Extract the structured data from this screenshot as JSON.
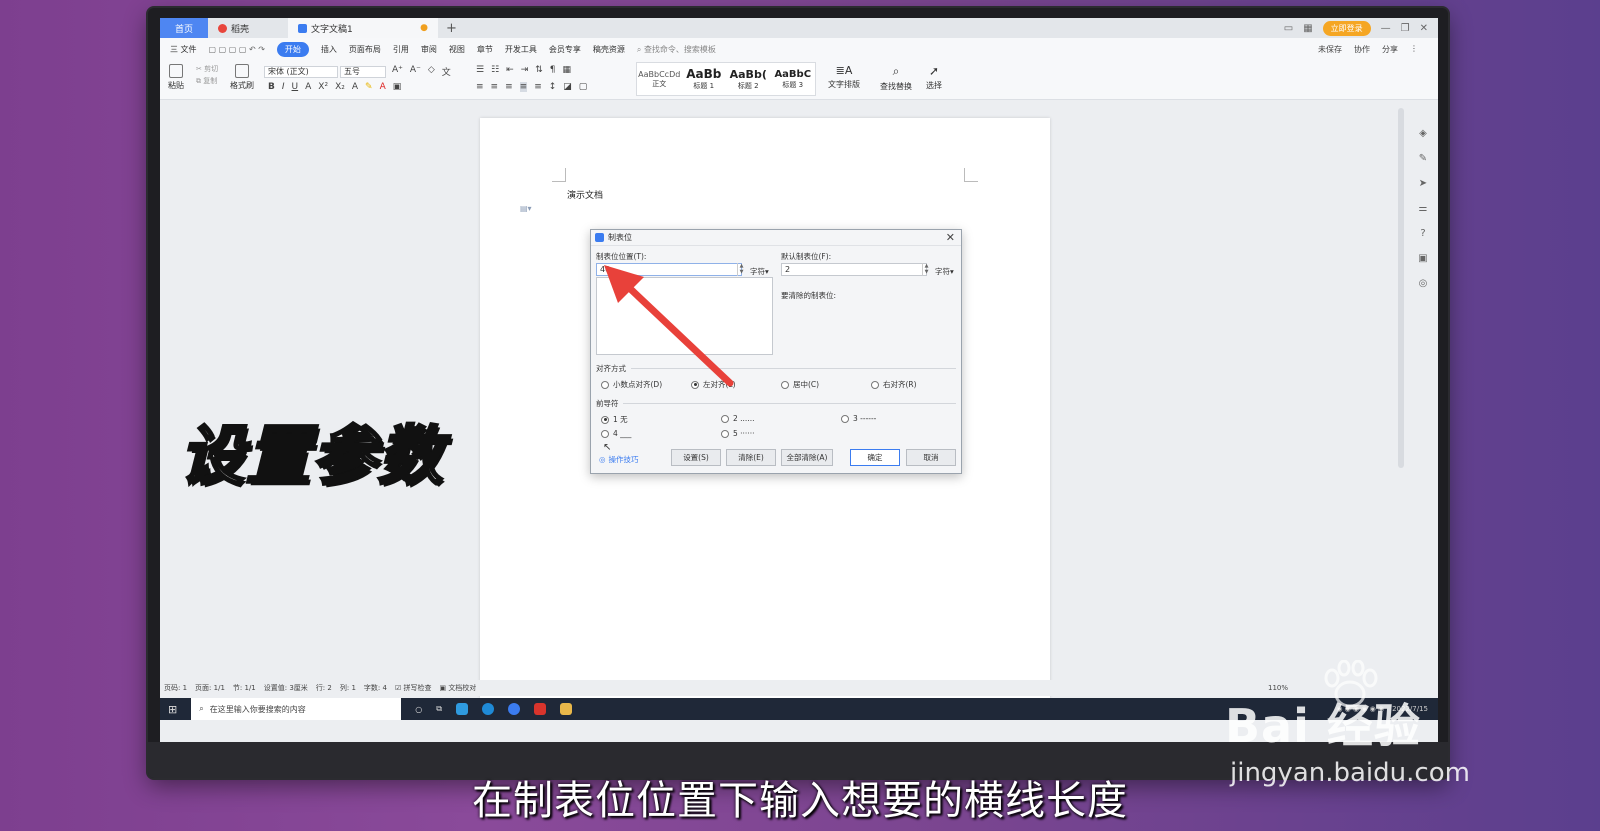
{
  "tabs": {
    "home": "首页",
    "templates": "稻壳",
    "document": "文字文稿1",
    "new_tab": "+",
    "login": "立即登录"
  },
  "menu": {
    "file": "三 文件",
    "items": [
      "开始",
      "插入",
      "页面布局",
      "引用",
      "审阅",
      "视图",
      "章节",
      "开发工具",
      "会员专享",
      "稿壳资源"
    ],
    "search": "查找命令、搜索模板",
    "unsaved": "未保存",
    "collab": "协作",
    "share": "分享"
  },
  "ribbon": {
    "paste": "粘贴",
    "cut": "剪切",
    "copy": "复制",
    "format_painter": "格式刷",
    "font_name": "宋体 (正文)",
    "font_size": "五号",
    "styles": [
      {
        "sample": "AaBbCcDd",
        "name": "正文"
      },
      {
        "sample": "AaBb",
        "name": "标题 1"
      },
      {
        "sample": "AaBb(",
        "name": "标题 2"
      },
      {
        "sample": "AaBbC",
        "name": "标题 3"
      }
    ],
    "text_layout": "文字排版",
    "find_replace": "查找替换",
    "select": "选择"
  },
  "document": {
    "body_text": "演示文档"
  },
  "dialog": {
    "title": "制表位",
    "tab_position_label": "制表位位置(T):",
    "tab_position_value": "40",
    "unit": "字符",
    "default_tab_label": "默认制表位(F):",
    "default_tab_value": "2",
    "to_clear_label": "要清除的制表位:",
    "alignment_section": "对齐方式",
    "alignment_options": [
      "小数点对齐(D)",
      "左对齐(L)",
      "居中(C)",
      "右对齐(R)"
    ],
    "alignment_selected": "左对齐(L)",
    "leader_section": "前导符",
    "leader_options": [
      "1 无",
      "2 ......",
      "3 ------",
      "4 ___",
      "5 ······"
    ],
    "leader_selected": "1 无",
    "tips": "操作技巧",
    "btn_set": "设置(S)",
    "btn_clear": "清除(E)",
    "btn_clear_all": "全部清除(A)",
    "btn_ok": "确定",
    "btn_cancel": "取消"
  },
  "statusbar": {
    "page": "页码: 1",
    "pages": "页面: 1/1",
    "section": "节: 1/1",
    "setting": "设置值: 3厘米",
    "row": "行: 2",
    "col": "列: 1",
    "words": "字数: 4",
    "spell": "拼写检查",
    "proof": "文档校对",
    "zoom": "110%"
  },
  "taskbar": {
    "search_placeholder": "在这里输入你要搜索的内容",
    "date": "2022/7/15"
  },
  "overlay": {
    "caption": "设置参数",
    "subtitle": "在制表位位置下输入想要的横线长度",
    "watermark_logo": "Bai 经验",
    "watermark_url": "jingyan.baidu.com"
  },
  "colors": {
    "accent": "#3b7cf0",
    "arrow": "#e8413a",
    "background": "#7d3f8f"
  }
}
